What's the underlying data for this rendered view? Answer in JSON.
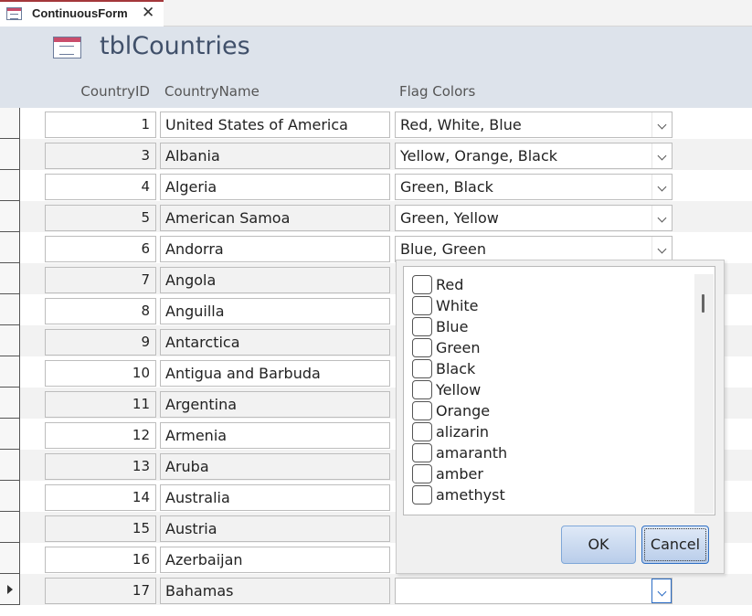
{
  "tab": {
    "label": "ContinuousForm",
    "close_glyph": "✕",
    "icon": "form-icon"
  },
  "header": {
    "title": "tblCountries",
    "icon": "form-icon",
    "columns": {
      "id": "CountryID",
      "name": "CountryName",
      "flag": "Flag Colors"
    }
  },
  "rows": [
    {
      "id": "1",
      "name": "United States of America",
      "flag": "Red, White, Blue"
    },
    {
      "id": "3",
      "name": "Albania",
      "flag": "Yellow, Orange, Black"
    },
    {
      "id": "4",
      "name": "Algeria",
      "flag": "Green, Black"
    },
    {
      "id": "5",
      "name": "American Samoa",
      "flag": "Green, Yellow"
    },
    {
      "id": "6",
      "name": "Andorra",
      "flag": "Blue, Green"
    },
    {
      "id": "7",
      "name": "Angola",
      "flag": ""
    },
    {
      "id": "8",
      "name": "Anguilla",
      "flag": ""
    },
    {
      "id": "9",
      "name": "Antarctica",
      "flag": ""
    },
    {
      "id": "10",
      "name": "Antigua and Barbuda",
      "flag": ""
    },
    {
      "id": "11",
      "name": "Argentina",
      "flag": ""
    },
    {
      "id": "12",
      "name": "Armenia",
      "flag": ""
    },
    {
      "id": "13",
      "name": "Aruba",
      "flag": ""
    },
    {
      "id": "14",
      "name": "Australia",
      "flag": ""
    },
    {
      "id": "15",
      "name": "Austria",
      "flag": ""
    },
    {
      "id": "16",
      "name": "Azerbaijan",
      "flag": ""
    },
    {
      "id": "17",
      "name": "Bahamas",
      "flag": ""
    }
  ],
  "current_row_index": 15,
  "popup": {
    "items": [
      "Red",
      "White",
      "Blue",
      "Green",
      "Black",
      "Yellow",
      "Orange",
      "alizarin",
      "amaranth",
      "amber",
      "amethyst"
    ],
    "ok_label": "OK",
    "cancel_label": "Cancel"
  },
  "colors": {
    "tab_accent": "#a4373a",
    "header_bg": "#dde3eb",
    "title_color": "#40506a",
    "button_bg": "#c7d8ef"
  }
}
